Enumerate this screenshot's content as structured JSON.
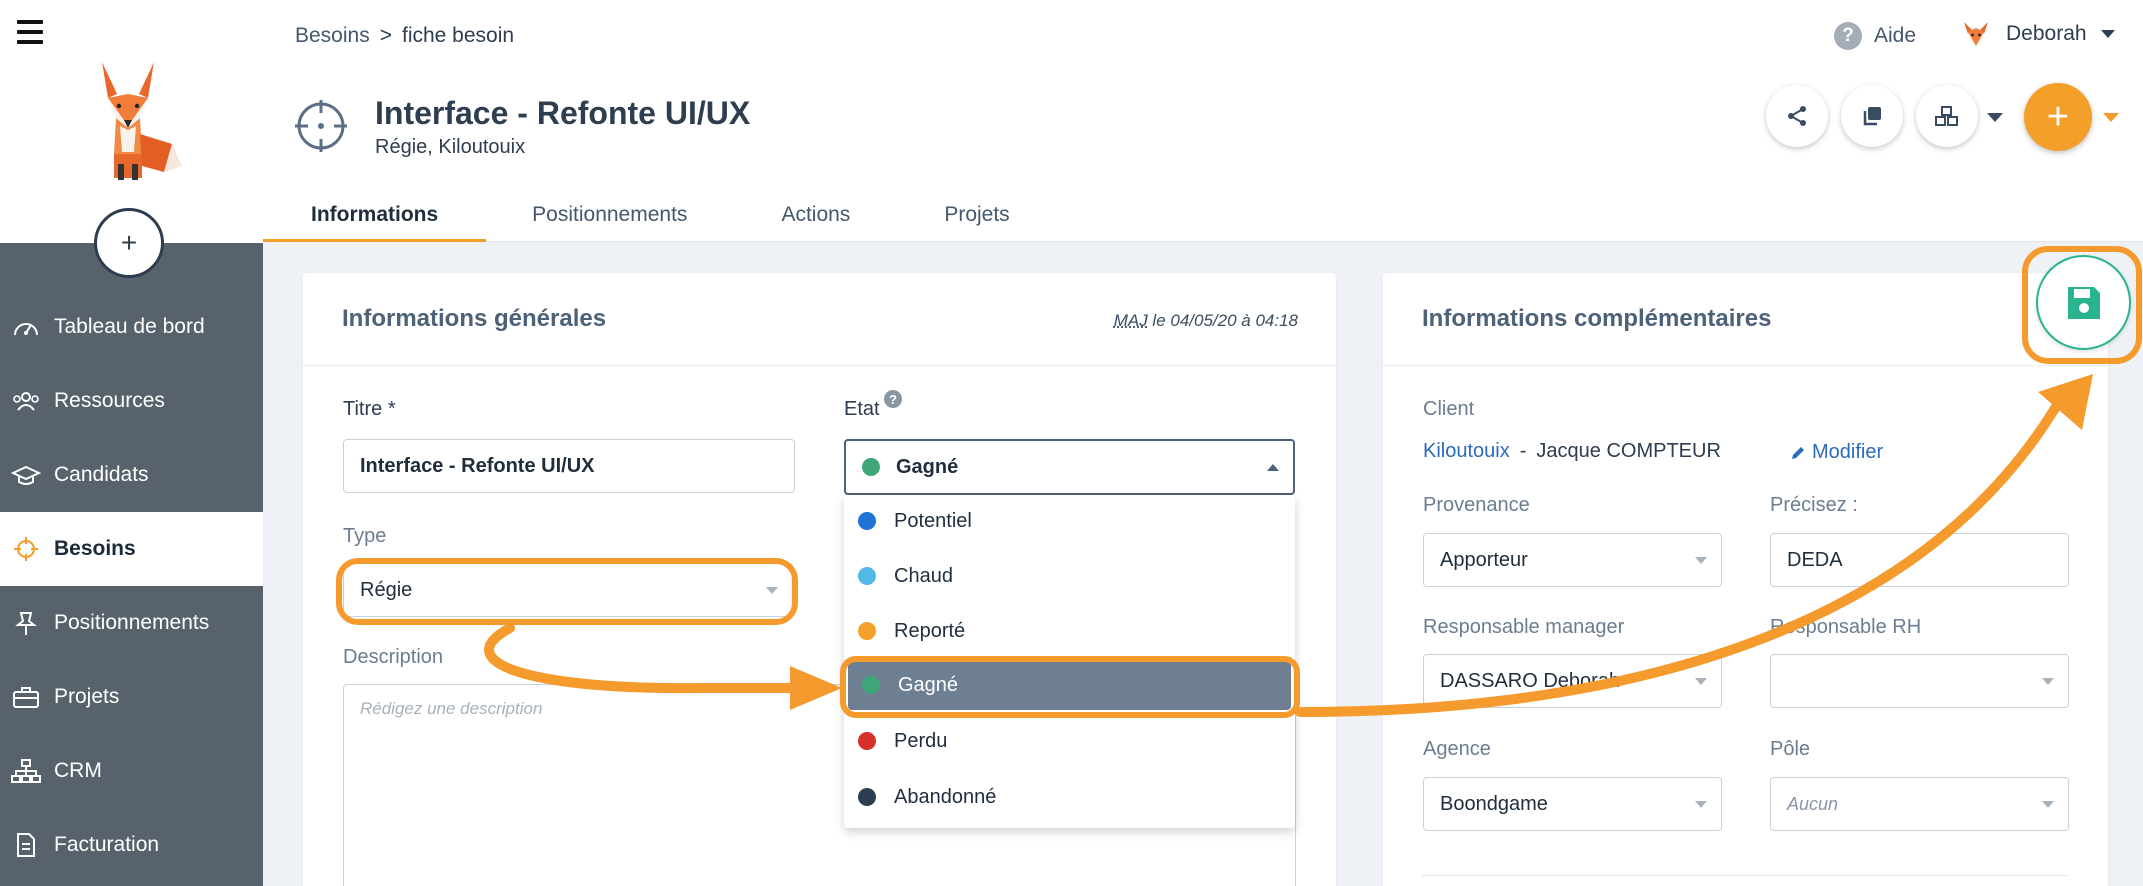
{
  "sidebar": {
    "add_label": "+",
    "items": [
      {
        "label": "Tableau de bord",
        "icon": "dashboard-icon"
      },
      {
        "label": "Ressources",
        "icon": "users-icon"
      },
      {
        "label": "Candidats",
        "icon": "graduation-cap-icon"
      },
      {
        "label": "Besoins",
        "icon": "crosshair-icon",
        "active": true
      },
      {
        "label": "Positionnements",
        "icon": "pin-icon"
      },
      {
        "label": "Projets",
        "icon": "briefcase-icon"
      },
      {
        "label": "CRM",
        "icon": "sitemap-icon"
      },
      {
        "label": "Facturation",
        "icon": "document-icon"
      }
    ]
  },
  "breadcrumb": {
    "parent": "Besoins",
    "separator": ">",
    "current": "fiche besoin"
  },
  "header": {
    "title": "Interface - Refonte UI/UX",
    "subtitle": "Régie, Kiloutouix",
    "help_label": "Aide",
    "help_glyph": "?",
    "user_name": "Deborah",
    "fab_label": "+"
  },
  "tabs": [
    {
      "label": "Informations",
      "active": true
    },
    {
      "label": "Positionnements"
    },
    {
      "label": "Actions"
    },
    {
      "label": "Projets"
    }
  ],
  "general": {
    "title": "Informations générales",
    "maj_prefix": "MAJ",
    "maj_suffix": " le 04/05/20 à 04:18",
    "titre_label": "Titre *",
    "titre_value": "Interface - Refonte UI/UX",
    "etat_label": "Etat",
    "etat_help": "?",
    "etat_value": "Gagné",
    "type_label": "Type",
    "type_value": "Régie",
    "description_label": "Description",
    "description_placeholder": "Rédigez une description"
  },
  "etat_options": [
    {
      "label": "Potentiel",
      "color": "#1e73d6"
    },
    {
      "label": "Chaud",
      "color": "#54b8e6"
    },
    {
      "label": "Reporté",
      "color": "#f5a02b"
    },
    {
      "label": "Gagné",
      "color": "#3ea67a",
      "selected": true
    },
    {
      "label": "Perdu",
      "color": "#d6302a"
    },
    {
      "label": "Abandonné",
      "color": "#2b3e52"
    }
  ],
  "complementary": {
    "title": "Informations complémentaires",
    "client_label": "Client",
    "client_company": "Kiloutouix",
    "client_sep": "-",
    "client_contact": "Jacque COMPTEUR",
    "modify_label": "Modifier",
    "provenance_label": "Provenance",
    "provenance_value": "Apporteur",
    "precisez_label": "Précisez :",
    "precisez_value": "DEDA",
    "manager_label": "Responsable manager",
    "manager_value": "DASSARO Deborah",
    "rh_label": "Responsable RH",
    "rh_value": "",
    "agence_label": "Agence",
    "agence_value": "Boondgame",
    "pole_label": "Pôle",
    "pole_placeholder": "Aucun"
  },
  "colors": {
    "accent_orange": "#f59a2c",
    "save_green": "#29b38f",
    "sidebar_bg": "#58626d"
  }
}
